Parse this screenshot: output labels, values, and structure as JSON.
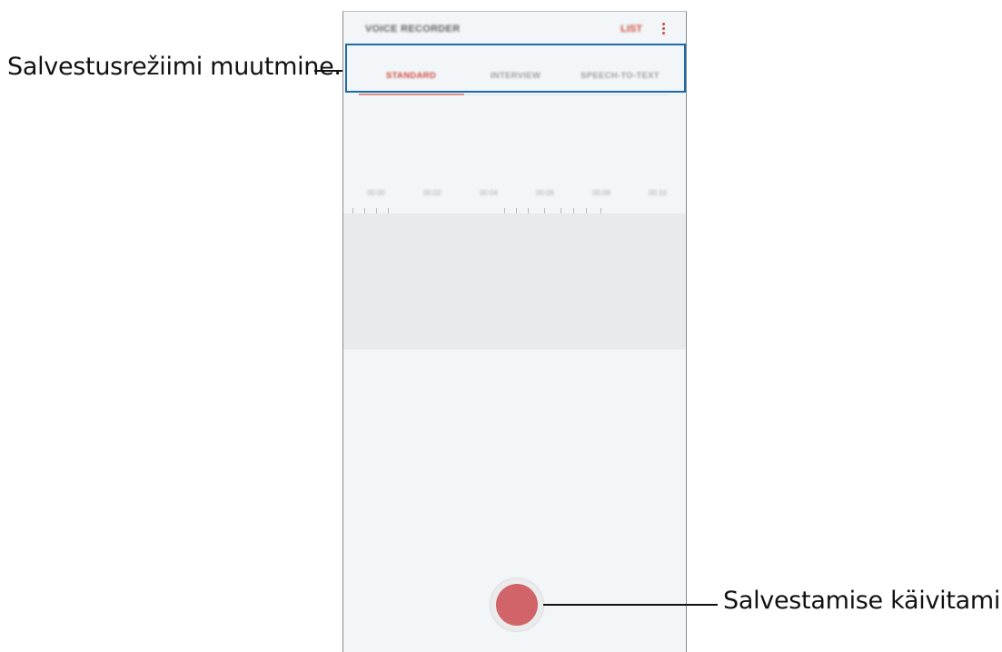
{
  "callouts": {
    "mode_change": "Salvestusrežiimi muutmine.",
    "start_recording": "Salvestamise käivitamine."
  },
  "app": {
    "title": "VOICE RECORDER",
    "list_label": "LIST",
    "more_icon": "more-vertical-icon",
    "accent_color": "#cf4a3d",
    "record_color": "#d06468",
    "highlight_color": "#1d6aa8"
  },
  "tabs": [
    {
      "label": "STANDARD",
      "active": true
    },
    {
      "label": "INTERVIEW",
      "active": false
    },
    {
      "label": "SPEECH-TO-TEXT",
      "active": false
    }
  ],
  "timeline": {
    "labels": [
      "00:00",
      "00:02",
      "00:04",
      "00:06",
      "00:08",
      "00:10"
    ]
  }
}
